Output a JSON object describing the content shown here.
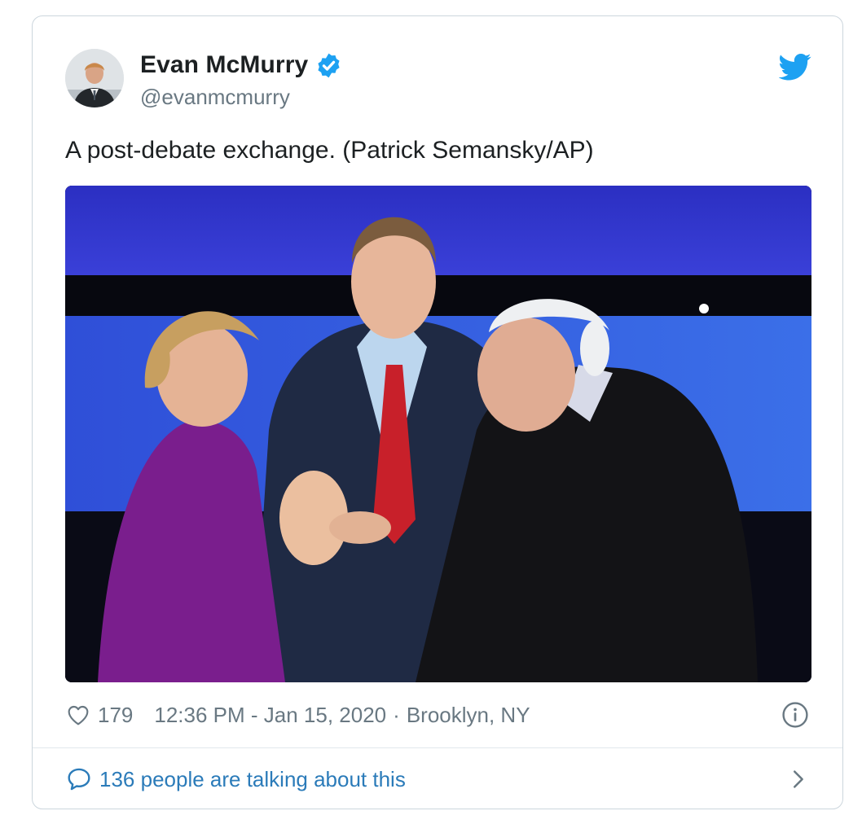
{
  "tweet": {
    "author": {
      "name": "Evan McMurry",
      "handle": "@evanmcmurry",
      "avatar_icon": "author-avatar",
      "verified": true
    },
    "text": "A post-debate exchange. (Patrick Semansky/AP)",
    "media": {
      "type": "photo",
      "subject": "three-people-on-debate-stage"
    },
    "likes": "179",
    "timestamp": "12:36 PM - Jan 15, 2020",
    "separator": "·",
    "location": "Brooklyn, NY",
    "footer": {
      "talking_label": "136 people are talking about this"
    }
  },
  "colors": {
    "twitter_blue": "#1da1f2",
    "link_blue": "#2b7bb9",
    "secondary_text": "#697882",
    "primary_text": "#1c2022",
    "border": "#ccd6dd"
  },
  "icons": [
    "verified-badge-icon",
    "twitter-bird-icon",
    "heart-icon",
    "info-icon",
    "speech-bubble-icon",
    "chevron-right-icon"
  ]
}
